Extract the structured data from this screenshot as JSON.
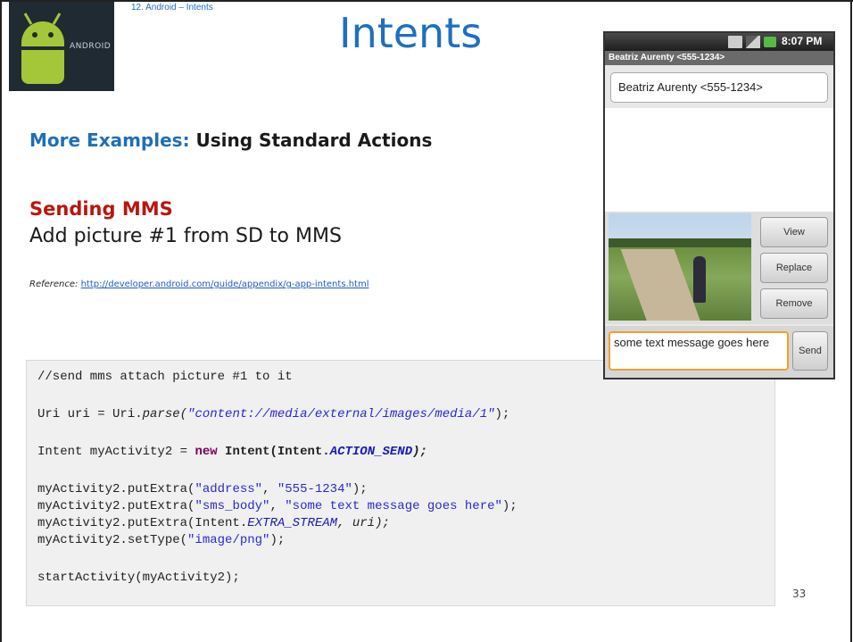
{
  "header": {
    "breadcrumb": "12. Android – Intents",
    "title": "Intents",
    "logo_text": "ANDROID"
  },
  "content": {
    "examples_label": "More Examples:",
    "examples_text": " Using Standard Actions",
    "section_heading": "Sending MMS",
    "subheading": "Add picture #1 from SD to MMS",
    "reference_label": "Reference:",
    "reference_url": "http://developer.android.com/guide/appendix/g-app-intents.html"
  },
  "code": {
    "comment": "//send mms attach picture #1 to it",
    "l2_a": "Uri uri = Uri.",
    "l2_b": "parse(",
    "l2_str": "\"content://media/external/images/media/1\"",
    "l2_c": ");",
    "l3_a": "Intent myActivity2 = ",
    "l3_kw": "new",
    "l3_b": " Intent(Intent.",
    "l3_const": "ACTION_SEND",
    "l3_c": ");",
    "l4_a": "myActivity2.putExtra(",
    "l4_s1": "\"address\"",
    "l4_b": ", ",
    "l4_s2": "\"555-1234\"",
    "l4_c": ");",
    "l5_a": "myActivity2.putExtra(",
    "l5_s1": "\"sms_body\"",
    "l5_b": ", ",
    "l5_s2": "\"some text message goes here\"",
    "l5_c": ");",
    "l6_a": "myActivity2.putExtra(Intent.",
    "l6_const": "EXTRA_STREAM",
    "l6_b": ", uri);",
    "l7_a": "myActivity2.setType(",
    "l7_s": "\"image/png\"",
    "l7_b": ");",
    "l8": "startActivity(myActivity2);"
  },
  "phone": {
    "time": "8:07 PM",
    "contact_header": "Beatriz Aurenty <555-1234>",
    "to_field": "Beatriz Aurenty <555-1234>",
    "btn_view": "View",
    "btn_replace": "Replace",
    "btn_remove": "Remove",
    "message_text": "some text message goes here",
    "btn_send": "Send"
  },
  "page_number": "33"
}
